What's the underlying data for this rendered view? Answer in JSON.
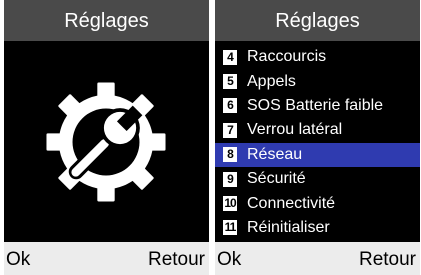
{
  "left_screen": {
    "title": "Réglages",
    "icon": "settings-wrench-gear-icon",
    "softkey_left": "Ok",
    "softkey_right": "Retour"
  },
  "right_screen": {
    "title": "Réglages",
    "softkey_left": "Ok",
    "softkey_right": "Retour",
    "selected_index": 4,
    "items": [
      {
        "num": "4",
        "label": "Raccourcis"
      },
      {
        "num": "5",
        "label": "Appels"
      },
      {
        "num": "6",
        "label": "SOS Batterie faible"
      },
      {
        "num": "7",
        "label": "Verrou latéral"
      },
      {
        "num": "8",
        "label": "Réseau"
      },
      {
        "num": "9",
        "label": "Sécurité"
      },
      {
        "num": "10",
        "label": "Connectivité"
      },
      {
        "num": "11",
        "label": "Réinitialiser"
      }
    ]
  },
  "colors": {
    "title_bar": "#4a4a4a",
    "selection": "#2f3bb0",
    "softkey_bar": "#ececec",
    "screen_bg": "#000000"
  }
}
